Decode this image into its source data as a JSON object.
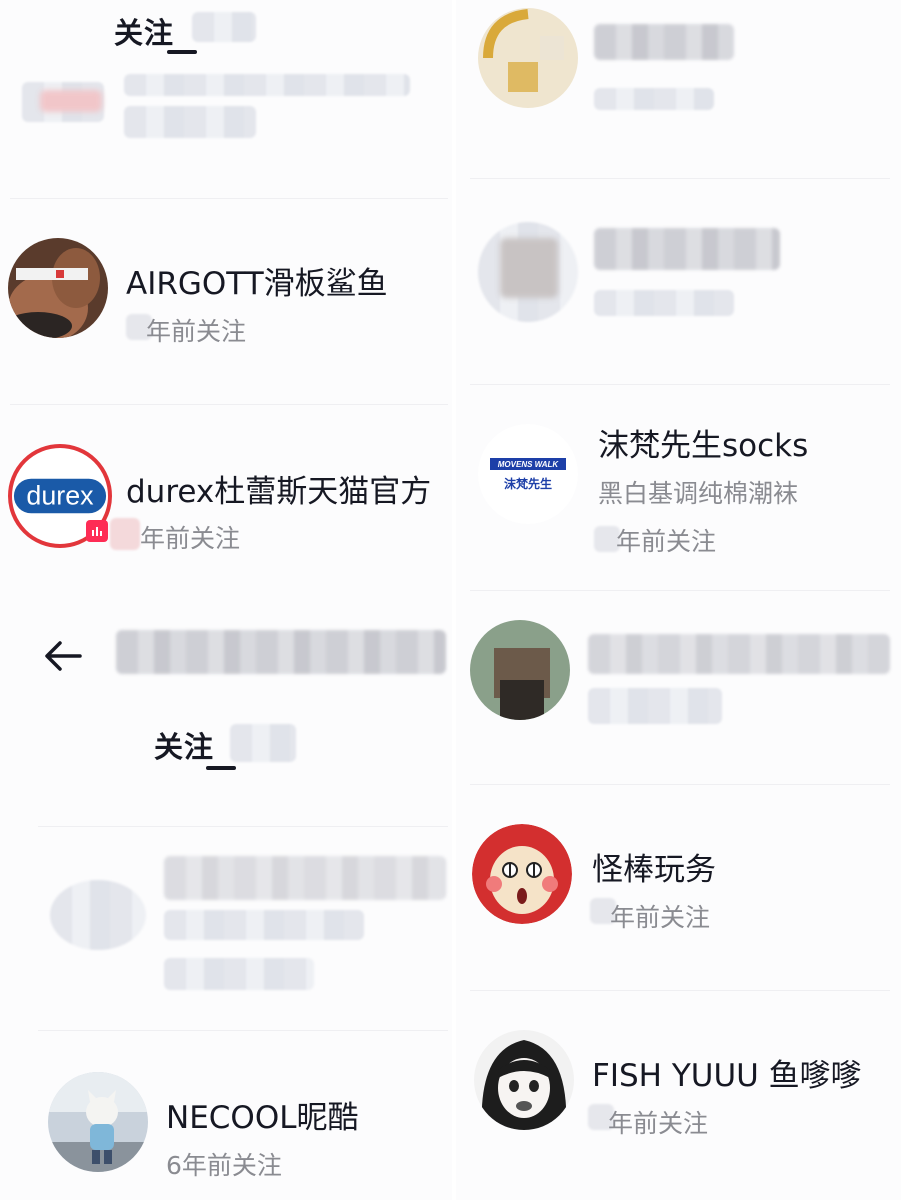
{
  "left": {
    "tab_title_top": "关注",
    "tab_title_bottom": "关注",
    "users": [
      {
        "name": "AIRGOTT滑板鲨鱼",
        "sub": "年前关注"
      },
      {
        "name": "durex杜蕾斯天猫官方",
        "sub": "年前关注"
      },
      {
        "name": "NECOOL昵酷",
        "sub": "6年前关注"
      }
    ]
  },
  "right": {
    "users": [
      {
        "name": "沫梵先生socks",
        "desc": "黑白基调纯棉潮袜",
        "sub": "年前关注"
      },
      {
        "name": "怪棒玩务",
        "sub": "年前关注"
      },
      {
        "name": "FISH YUUU 鱼嗲嗲",
        "sub": "年前关注"
      }
    ]
  },
  "logos": {
    "durex": "durex",
    "movens_line1": "MOVENS WALK",
    "movens_line2": "沫梵先生"
  },
  "colors": {
    "text": "#161823",
    "subtext": "#8a8b91",
    "durex_blue": "#1a5aa8",
    "durex_ring": "#e2363b",
    "movens_blue": "#1d3fa8",
    "live_badge": "#fe2c55"
  }
}
